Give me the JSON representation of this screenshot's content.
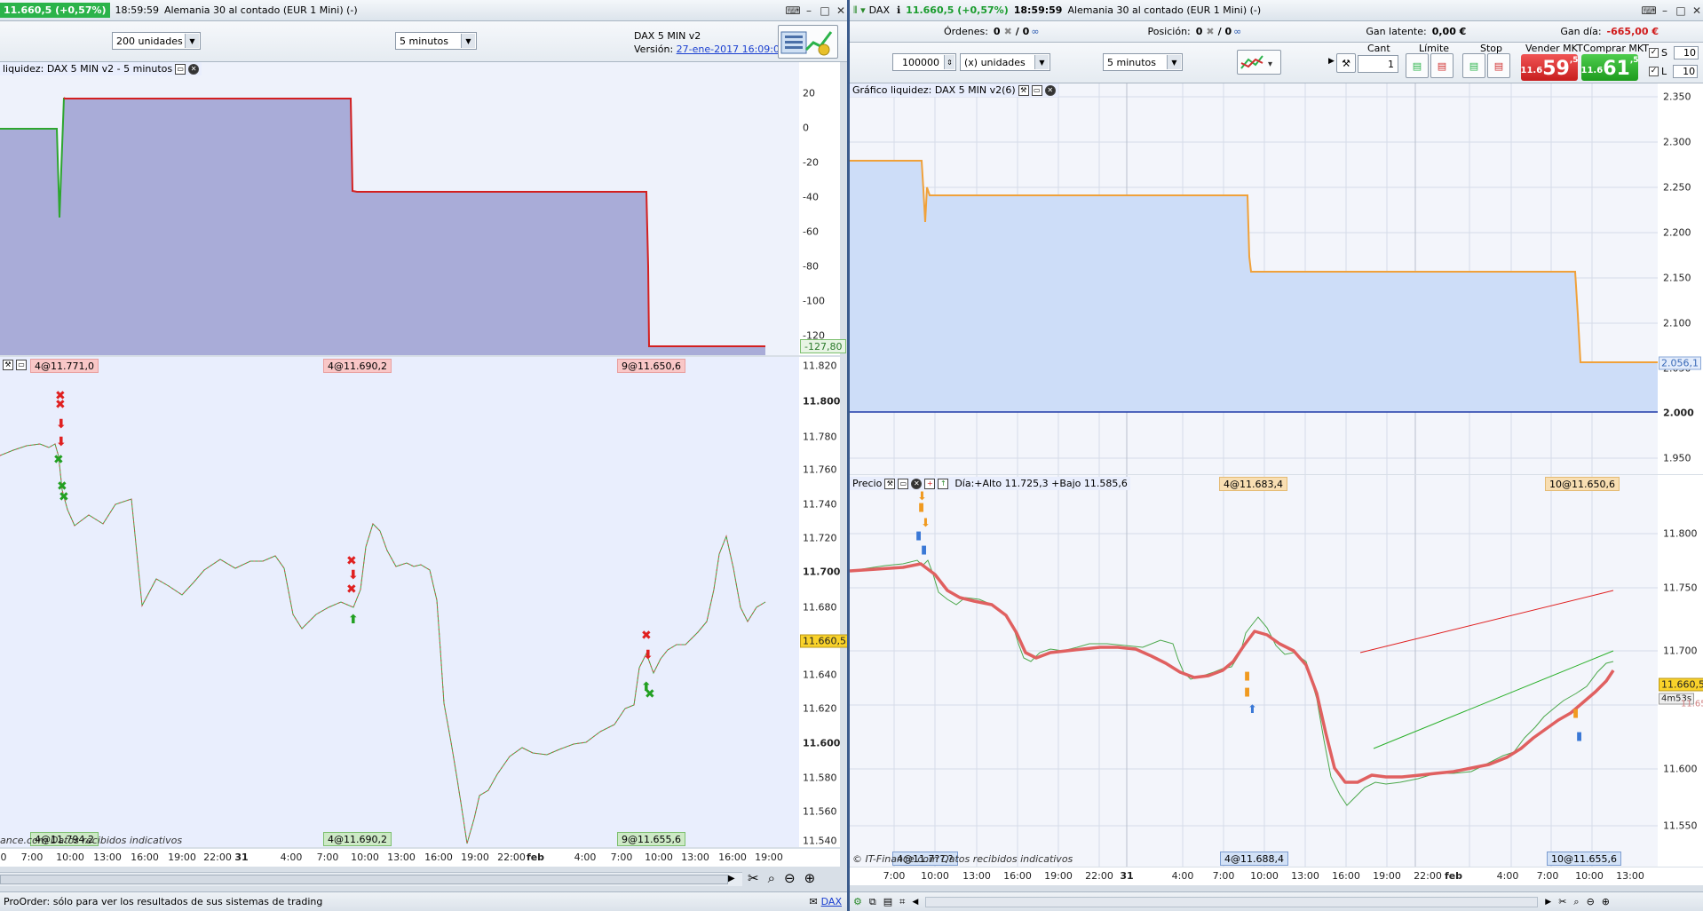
{
  "left_window": {
    "price_badge": "11.660,5 (+0,57%)",
    "time": "18:59:59",
    "instrument": "Alemania 30 al contado (EUR 1 Mini) (-)",
    "units_select": "200 unidades",
    "timeframe_select": "5 minutos",
    "system_name": "DAX 5 MIN v2",
    "version_label": "Versión:",
    "version_link": "27-ene-2017 16:09:01",
    "equity_chart": {
      "label": "liquidez: DAX 5 MIN v2 - 5 minutos",
      "last_value_tag": "-127,80",
      "y_ticks": [
        "20",
        "0",
        "-20",
        "-40",
        "-60",
        "-80",
        "-100",
        "-120"
      ]
    },
    "price_chart": {
      "top_tags": [
        "4@11.771,0",
        "4@11.690,2",
        "9@11.650,6"
      ],
      "bottom_tags": [
        "4@11.794,2",
        "4@11.690,2",
        "9@11.655,6"
      ],
      "last_price_tag": "11.660,5",
      "watermark": "ance.com Datos recibidos indicativos",
      "y_ticks": [
        "11.820",
        "11.800",
        "11.780",
        "11.760",
        "11.740",
        "11.720",
        "11.700",
        "11.680",
        "11.660",
        "11.640",
        "11.620",
        "11.600",
        "11.580",
        "11.560",
        "11.540"
      ],
      "bold_ticks": [
        "11.800",
        "11.700",
        "11.600"
      ]
    },
    "x_ticks": [
      "0",
      "7:00",
      "10:00",
      "13:00",
      "16:00",
      "19:00",
      "22:00",
      "31",
      "4:00",
      "7:00",
      "10:00",
      "13:00",
      "16:00",
      "19:00",
      "22:00",
      "feb",
      "4:00",
      "7:00",
      "10:00",
      "13:00",
      "16:00",
      "19:00"
    ],
    "status_text": "ProOrder: sólo para ver los resultados de sus sistemas de trading"
  },
  "right_window": {
    "instrument_code": "DAX",
    "price": "11.660,5 (+0,57%)",
    "time": "18:59:59",
    "instrument": "Alemania 30 al contado (EUR 1 Mini) (-)",
    "orders_label": "Órdenes:",
    "orders_value": "0",
    "orders_sep": "/ 0",
    "position_label": "Posición:",
    "position_value": "0",
    "position_sep": "/ 0",
    "unrealized_label": "Gan latente:",
    "unrealized_value": "0,00 €",
    "day_gain_label": "Gan día:",
    "day_gain_value": "-665,00 €",
    "capital_input": "100000",
    "units_select": "(x) unidades",
    "timeframe_select": "5 minutos",
    "qty_header": "Cant",
    "qty_value": "1",
    "limit_header": "Límite",
    "stop_header": "Stop",
    "sell_header": "Vender MKT",
    "buy_header": "Comprar MKT",
    "sell_price_small": "11.6",
    "sell_price_big": "59",
    "sell_price_sup": ",5",
    "buy_price_small": "11.6",
    "buy_price_big": "61",
    "buy_price_sup": ",5",
    "s_label": "S",
    "s_value": "10",
    "l_label": "L",
    "l_value": "10",
    "equity_chart": {
      "label": "Gráfico liquidez: DAX 5 MIN v2(6)",
      "last_value_tag": "2.056,1",
      "y_ticks": [
        "2.350",
        "2.300",
        "2.250",
        "2.200",
        "2.150",
        "2.100",
        "2.050",
        "2.000",
        "1.950"
      ],
      "bold_ticks": [
        "2.000"
      ]
    },
    "price_chart": {
      "label": "Precio",
      "day_info": "Día:+Alto 11.725,3 +Bajo 11.585,6",
      "top_tags": [
        "4@11.683,4",
        "10@11.650,6"
      ],
      "bottom_tags": [
        "4@11.7??,?",
        "4@11.688,4",
        "10@11.655,6"
      ],
      "last_price_tag": "11.660,5",
      "countdown_tag": "4m53s",
      "secondary_tag": "11.650,0",
      "watermark": "© IT-Finance.com Datos recibidos indicativos",
      "y_ticks": [
        "11.800",
        "11.750",
        "11.700",
        "11.650",
        "11.600",
        "11.550"
      ]
    },
    "x_ticks": [
      "7:00",
      "10:00",
      "13:00",
      "16:00",
      "19:00",
      "22:00",
      "31",
      "4:00",
      "7:00",
      "10:00",
      "13:00",
      "16:00",
      "19:00",
      "22:00",
      "feb",
      "4:00",
      "7:00",
      "10:00",
      "13:00"
    ]
  },
  "status_dax_link": "DAX"
}
